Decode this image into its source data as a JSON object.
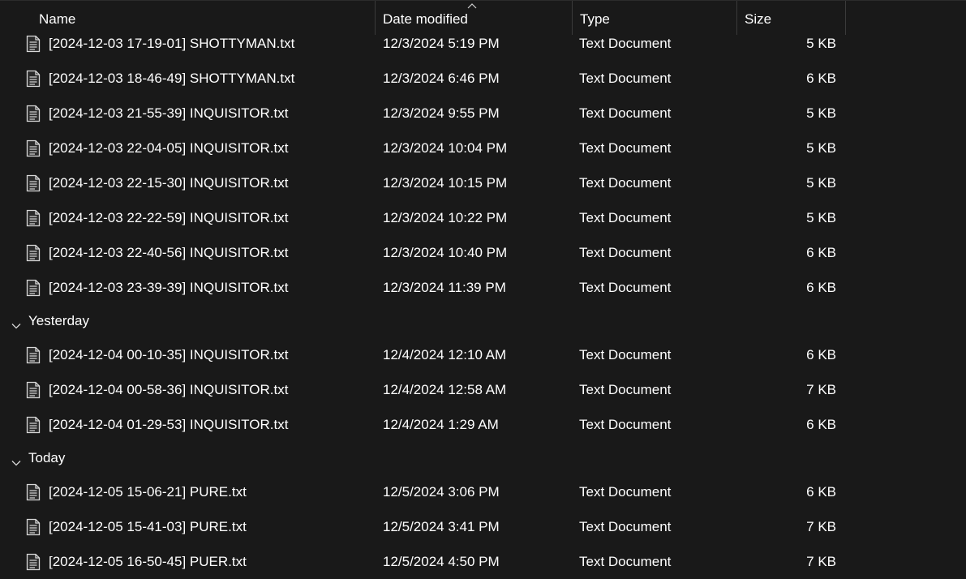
{
  "columns": {
    "name": "Name",
    "date": "Date modified",
    "type": "Type",
    "size": "Size"
  },
  "icons": {
    "file": "text-file-icon",
    "chevron": "chevron-down-icon",
    "sort": "sort-up-icon"
  },
  "colors": {
    "background": "#191919",
    "text": "#ffffff",
    "divider": "#3a3a3a"
  },
  "groups": [
    {
      "label": "",
      "files": [
        {
          "name": "[2024-12-03 17-19-01] SHOTTYMAN.txt",
          "date": "12/3/2024 5:19 PM",
          "type": "Text Document",
          "size": "5 KB"
        },
        {
          "name": "[2024-12-03 18-46-49] SHOTTYMAN.txt",
          "date": "12/3/2024 6:46 PM",
          "type": "Text Document",
          "size": "6 KB"
        },
        {
          "name": "[2024-12-03 21-55-39] INQUISITOR.txt",
          "date": "12/3/2024 9:55 PM",
          "type": "Text Document",
          "size": "5 KB"
        },
        {
          "name": "[2024-12-03 22-04-05] INQUISITOR.txt",
          "date": "12/3/2024 10:04 PM",
          "type": "Text Document",
          "size": "5 KB"
        },
        {
          "name": "[2024-12-03 22-15-30] INQUISITOR.txt",
          "date": "12/3/2024 10:15 PM",
          "type": "Text Document",
          "size": "5 KB"
        },
        {
          "name": "[2024-12-03 22-22-59] INQUISITOR.txt",
          "date": "12/3/2024 10:22 PM",
          "type": "Text Document",
          "size": "5 KB"
        },
        {
          "name": "[2024-12-03 22-40-56] INQUISITOR.txt",
          "date": "12/3/2024 10:40 PM",
          "type": "Text Document",
          "size": "6 KB"
        },
        {
          "name": "[2024-12-03 23-39-39] INQUISITOR.txt",
          "date": "12/3/2024 11:39 PM",
          "type": "Text Document",
          "size": "6 KB"
        }
      ]
    },
    {
      "label": "Yesterday",
      "files": [
        {
          "name": "[2024-12-04 00-10-35] INQUISITOR.txt",
          "date": "12/4/2024 12:10 AM",
          "type": "Text Document",
          "size": "6 KB"
        },
        {
          "name": "[2024-12-04 00-58-36] INQUISITOR.txt",
          "date": "12/4/2024 12:58 AM",
          "type": "Text Document",
          "size": "7 KB"
        },
        {
          "name": "[2024-12-04 01-29-53] INQUISITOR.txt",
          "date": "12/4/2024 1:29 AM",
          "type": "Text Document",
          "size": "6 KB"
        }
      ]
    },
    {
      "label": "Today",
      "files": [
        {
          "name": "[2024-12-05 15-06-21] PURE.txt",
          "date": "12/5/2024 3:06 PM",
          "type": "Text Document",
          "size": "6 KB"
        },
        {
          "name": "[2024-12-05 15-41-03] PURE.txt",
          "date": "12/5/2024 3:41 PM",
          "type": "Text Document",
          "size": "7 KB"
        },
        {
          "name": "[2024-12-05 16-50-45] PUER.txt",
          "date": "12/5/2024 4:50 PM",
          "type": "Text Document",
          "size": "7 KB"
        }
      ]
    }
  ]
}
